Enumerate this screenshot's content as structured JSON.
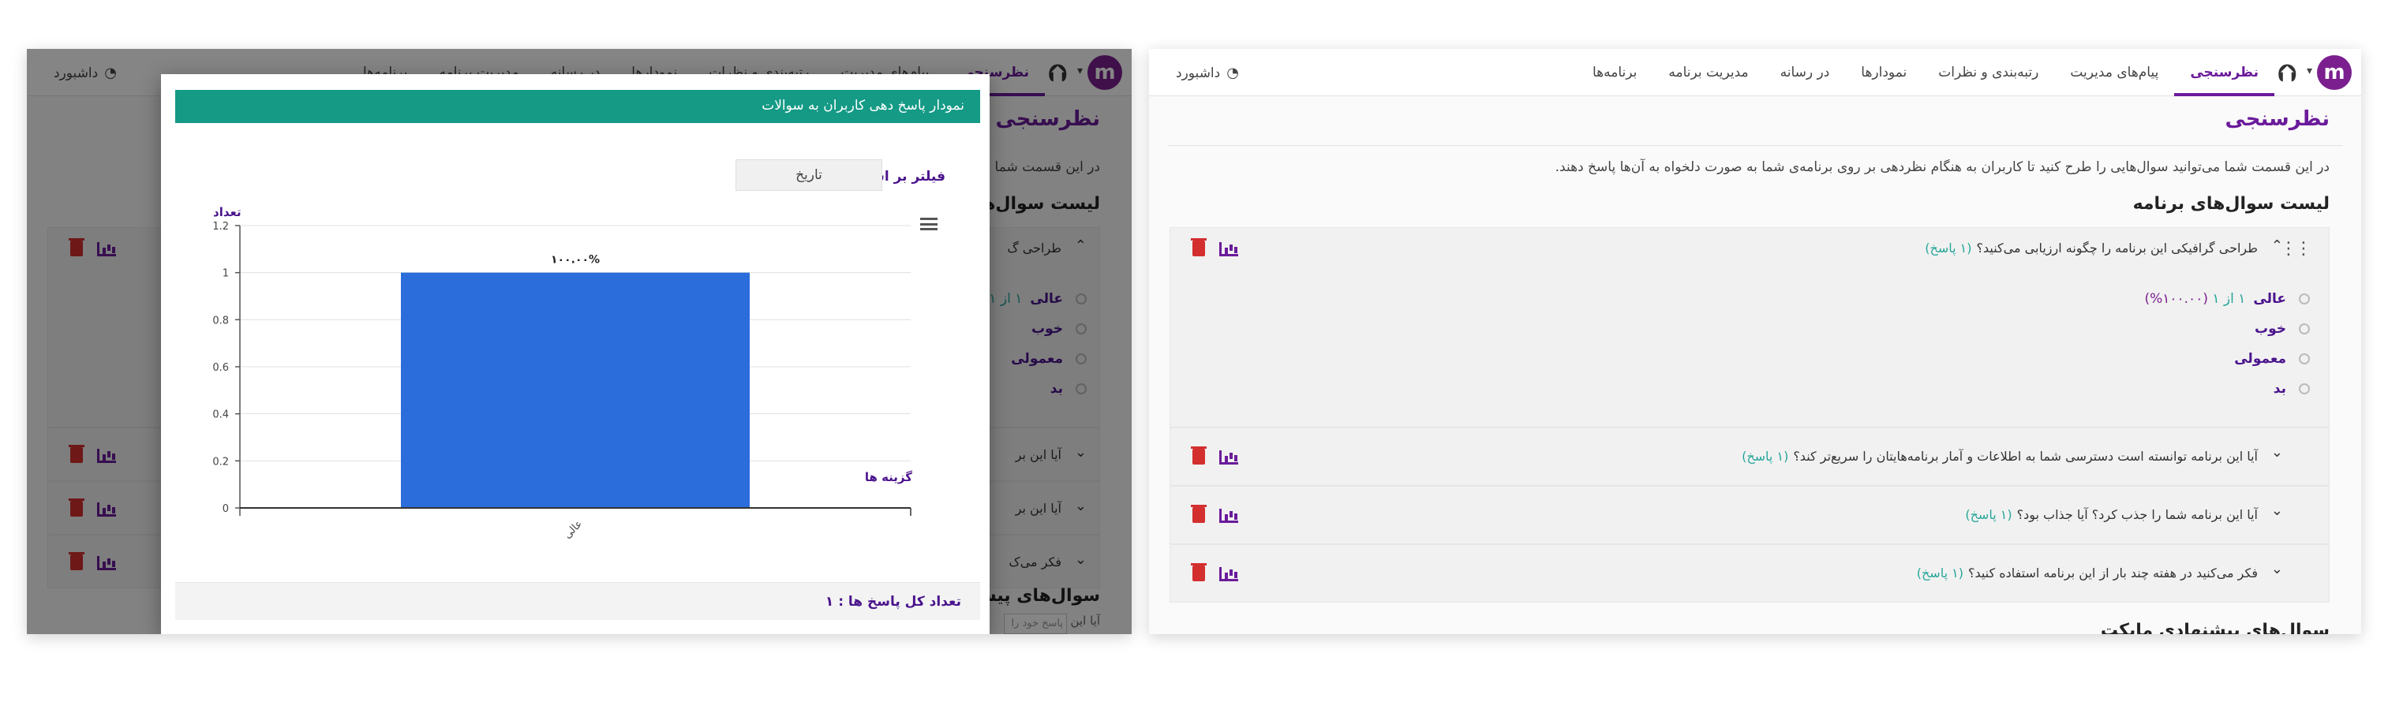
{
  "nav": {
    "brand": "برنامه‌ها",
    "items": [
      "مدیریت برنامه",
      "در رسانه",
      "نمودارها",
      "رتبه‌بندی و نظرات",
      "پیام‌های مدیریت",
      "نظرسنجی"
    ],
    "active": "نظرسنجی",
    "dashboard": "داشبورد",
    "logo_letter": "m"
  },
  "page": {
    "title": "نظرسنجی",
    "intro": "در این قسمت شما می‌توانید سوال‌هایی را طرح کنید تا کاربران به هنگام نظردهی بر روی برنامه‌ی شما به صورت دلخواه به آن‌ها پاسخ دهند.",
    "list_title": "لیست سوال‌های برنامه",
    "suggested_title": "سوال‌های پیشنهادی مایکت"
  },
  "questions": [
    {
      "text": "طراحی گرافیکی این برنامه را چگونه ارزیابی می‌کنید؟",
      "count": "(۱ پاسخ)",
      "expanded": true,
      "options": [
        {
          "label": "عالی",
          "result": "۱ از ۱",
          "percent": "(۱۰۰.۰۰%)"
        },
        {
          "label": "خوب"
        },
        {
          "label": "معمولی"
        },
        {
          "label": "بد"
        }
      ]
    },
    {
      "text": "آیا این برنامه توانسته است دسترسی شما به اطلاعات و آمار برنامه‌هایتان را سریع‌تر کند؟",
      "count": "(۱ پاسخ)"
    },
    {
      "text": "آیا این برنامه شما را جذب کرد؟ آیا جذاب بود؟",
      "count": "(۱ پاسخ)"
    },
    {
      "text": "فکر می‌کنید در هفته چند بار از این برنامه استفاده کنید؟",
      "count": "(۱ پاسخ)"
    }
  ],
  "left_bg": {
    "q1_short": "طراحی گ",
    "q_short": "آیا این بر",
    "q3_short": "آیا این بر",
    "q4_short": "فکر می‌ک",
    "opt1": "عالی",
    "opt1_frac": "۱ از ۱ (۱",
    "intro_short": "در این قسمت شما م",
    "list_title_short": "لیست سوال‌های",
    "suggested_short": "سوال‌های پیشنهادی",
    "suggested_sub": "آیا این",
    "input_placeholder": "پاسخ خود را"
  },
  "modal": {
    "title": "نمودار پاسخ دهی کاربران به سوالات",
    "filter_label": "فیلتر بر اساس:",
    "filter_value": "تاریخ",
    "footer": "تعداد کل پاسخ ها : ۱"
  },
  "chart_data": {
    "type": "bar",
    "categories": [
      "عالی"
    ],
    "values": [
      1
    ],
    "data_labels": [
      "۱۰۰.۰۰%"
    ],
    "ylabel": "تعداد",
    "xlabel": "گزینه ها",
    "ylim": [
      0,
      1.2
    ],
    "yticks": [
      0,
      0.2,
      0.4,
      0.6,
      0.8,
      1,
      1.2
    ],
    "ytick_labels": [
      "0",
      "0.2",
      "0.4",
      "0.6",
      "0.8",
      "1",
      "1.2"
    ],
    "grid": true,
    "bar_color": "#2a6ddb"
  },
  "colors": {
    "accent": "#6a1b9a",
    "modal_header": "#149a85",
    "count_text": "#26a69a",
    "delete": "#d32f2f"
  },
  "icons": {
    "logo": "m-logo-icon",
    "dashboard": "gauge-icon",
    "delete": "trash-icon",
    "stats": "bar-chart-icon",
    "collapse": "chevron-up-icon",
    "expand": "chevron-down-icon",
    "drag": "drag-handle-icon",
    "menu": "hamburger-menu-icon"
  }
}
